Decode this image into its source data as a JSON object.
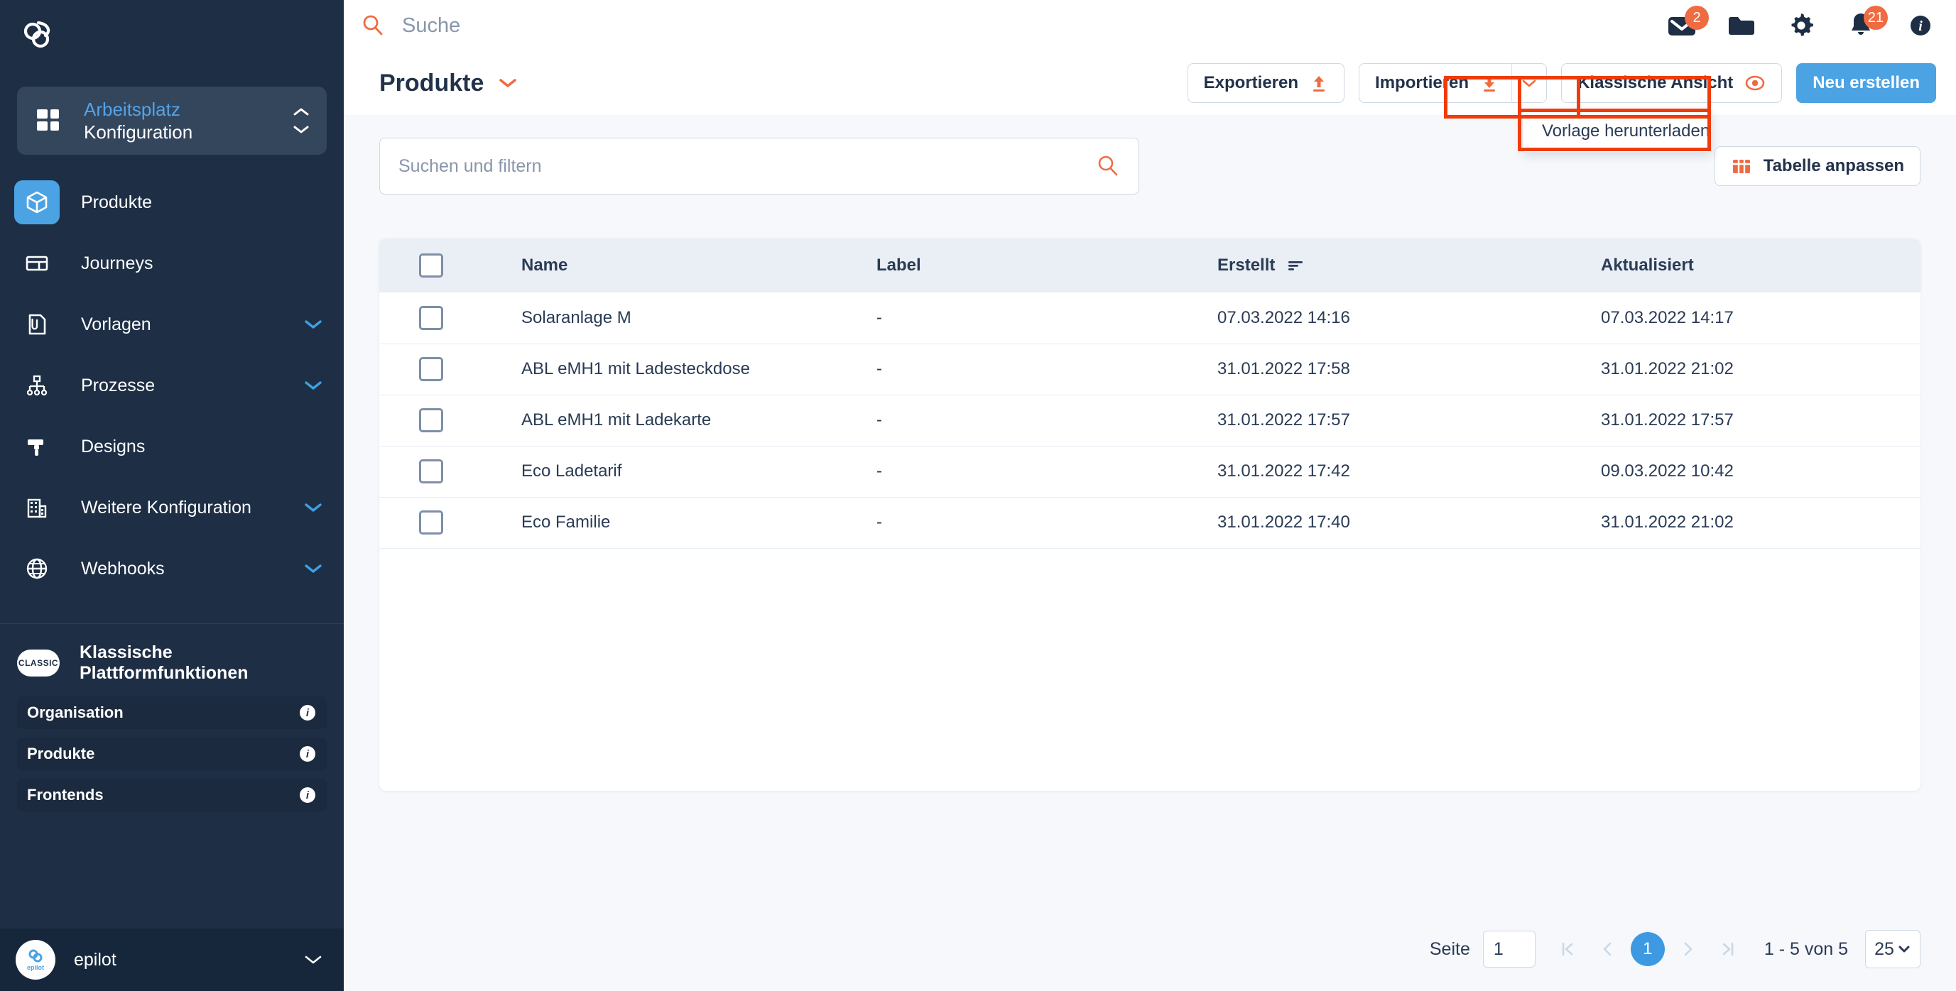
{
  "sidebar": {
    "logo_icon": "epilot-logo-icon",
    "workspace": {
      "icon": "grid-icon",
      "top_label": "Arbeitsplatz",
      "bottom_label": "Konfiguration",
      "up_icon": "chevron-up-icon",
      "down_icon": "chevron-down-icon"
    },
    "nav_items": [
      {
        "label": "Produkte",
        "icon": "box-icon",
        "active": true,
        "expandable": false
      },
      {
        "label": "Journeys",
        "icon": "layout-icon",
        "active": false,
        "expandable": false
      },
      {
        "label": "Vorlagen",
        "icon": "document-clip-icon",
        "active": false,
        "expandable": true
      },
      {
        "label": "Prozesse",
        "icon": "workflow-icon",
        "active": false,
        "expandable": true
      },
      {
        "label": "Designs",
        "icon": "paint-roller-icon",
        "active": false,
        "expandable": false
      },
      {
        "label": "Weitere Konfiguration",
        "icon": "building-icon",
        "active": false,
        "expandable": true
      },
      {
        "label": "Webhooks",
        "icon": "globe-icon",
        "active": false,
        "expandable": true
      }
    ],
    "classic": {
      "pill_label": "CLASSIC",
      "title": "Klassische Plattformfunktionen",
      "items": [
        {
          "label": "Organisation",
          "info_icon": "info-icon"
        },
        {
          "label": "Produkte",
          "info_icon": "info-icon"
        },
        {
          "label": "Frontends",
          "info_icon": "info-icon"
        }
      ]
    },
    "user": {
      "name": "epilot",
      "avatar_icon": "epilot-avatar-icon",
      "avatar_text": "epilot",
      "chevron_icon": "chevron-down-icon"
    }
  },
  "topbar": {
    "search": {
      "icon": "search-icon",
      "placeholder": "Suche",
      "value": ""
    },
    "icons": [
      {
        "name": "mail-icon",
        "badge": "2"
      },
      {
        "name": "folder-icon",
        "badge": ""
      },
      {
        "name": "gear-icon",
        "badge": ""
      },
      {
        "name": "bell-icon",
        "badge": "21"
      },
      {
        "name": "info-icon",
        "badge": ""
      }
    ]
  },
  "pagehead": {
    "title": "Produkte",
    "title_chevron_icon": "chevron-down-icon",
    "actions": {
      "export_label": "Exportieren",
      "export_icon": "upload-icon",
      "import_label": "Importieren",
      "import_icon": "download-icon",
      "import_arrow_icon": "chevron-down-icon",
      "classic_view_label": "Klassische Ansicht",
      "classic_view_icon": "eye-icon",
      "create_label": "Neu erstellen"
    },
    "dropdown": {
      "items": [
        "Vorlage herunterladen"
      ]
    }
  },
  "filterbar": {
    "search_placeholder": "Suchen und filtern",
    "search_value": "",
    "search_icon": "search-icon",
    "customize_label": "Tabelle anpassen",
    "customize_icon": "table-columns-icon"
  },
  "table": {
    "select_all_checkbox": "checkbox-unchecked",
    "columns": [
      {
        "key": "name",
        "label": "Name",
        "sort_icon": ""
      },
      {
        "key": "label",
        "label": "Label",
        "sort_icon": ""
      },
      {
        "key": "created",
        "label": "Erstellt",
        "sort_icon": "sort-descending-icon"
      },
      {
        "key": "updated",
        "label": "Aktualisiert",
        "sort_icon": ""
      }
    ],
    "rows": [
      {
        "name": "Solaranlage M",
        "label": "-",
        "created": "07.03.2022 14:16",
        "updated": "07.03.2022 14:17"
      },
      {
        "name": "ABL eMH1 mit Ladesteckdose",
        "label": "-",
        "created": "31.01.2022 17:58",
        "updated": "31.01.2022 21:02"
      },
      {
        "name": "ABL eMH1 mit Ladekarte",
        "label": "-",
        "created": "31.01.2022 17:57",
        "updated": "31.01.2022 17:57"
      },
      {
        "name": "Eco Ladetarif",
        "label": "-",
        "created": "31.01.2022 17:42",
        "updated": "09.03.2022 10:42"
      },
      {
        "name": "Eco Familie",
        "label": "-",
        "created": "31.01.2022 17:40",
        "updated": "31.01.2022 21:02"
      }
    ]
  },
  "pager": {
    "page_label": "Seite",
    "page_value": "1",
    "first_icon": "chevron-first-icon",
    "prev_icon": "chevron-left-icon",
    "current_page": "1",
    "next_icon": "chevron-right-icon",
    "last_icon": "chevron-last-icon",
    "range_text": "1 - 5 von 5",
    "page_size": "25",
    "page_size_icon": "chevron-down-icon"
  },
  "colors": {
    "sidebar_bg": "#1d2e45",
    "accent_blue": "#4ba3e3",
    "accent_orange": "#ef6b42",
    "annotation_red": "#f03c0a",
    "text_dark": "#22324a"
  }
}
